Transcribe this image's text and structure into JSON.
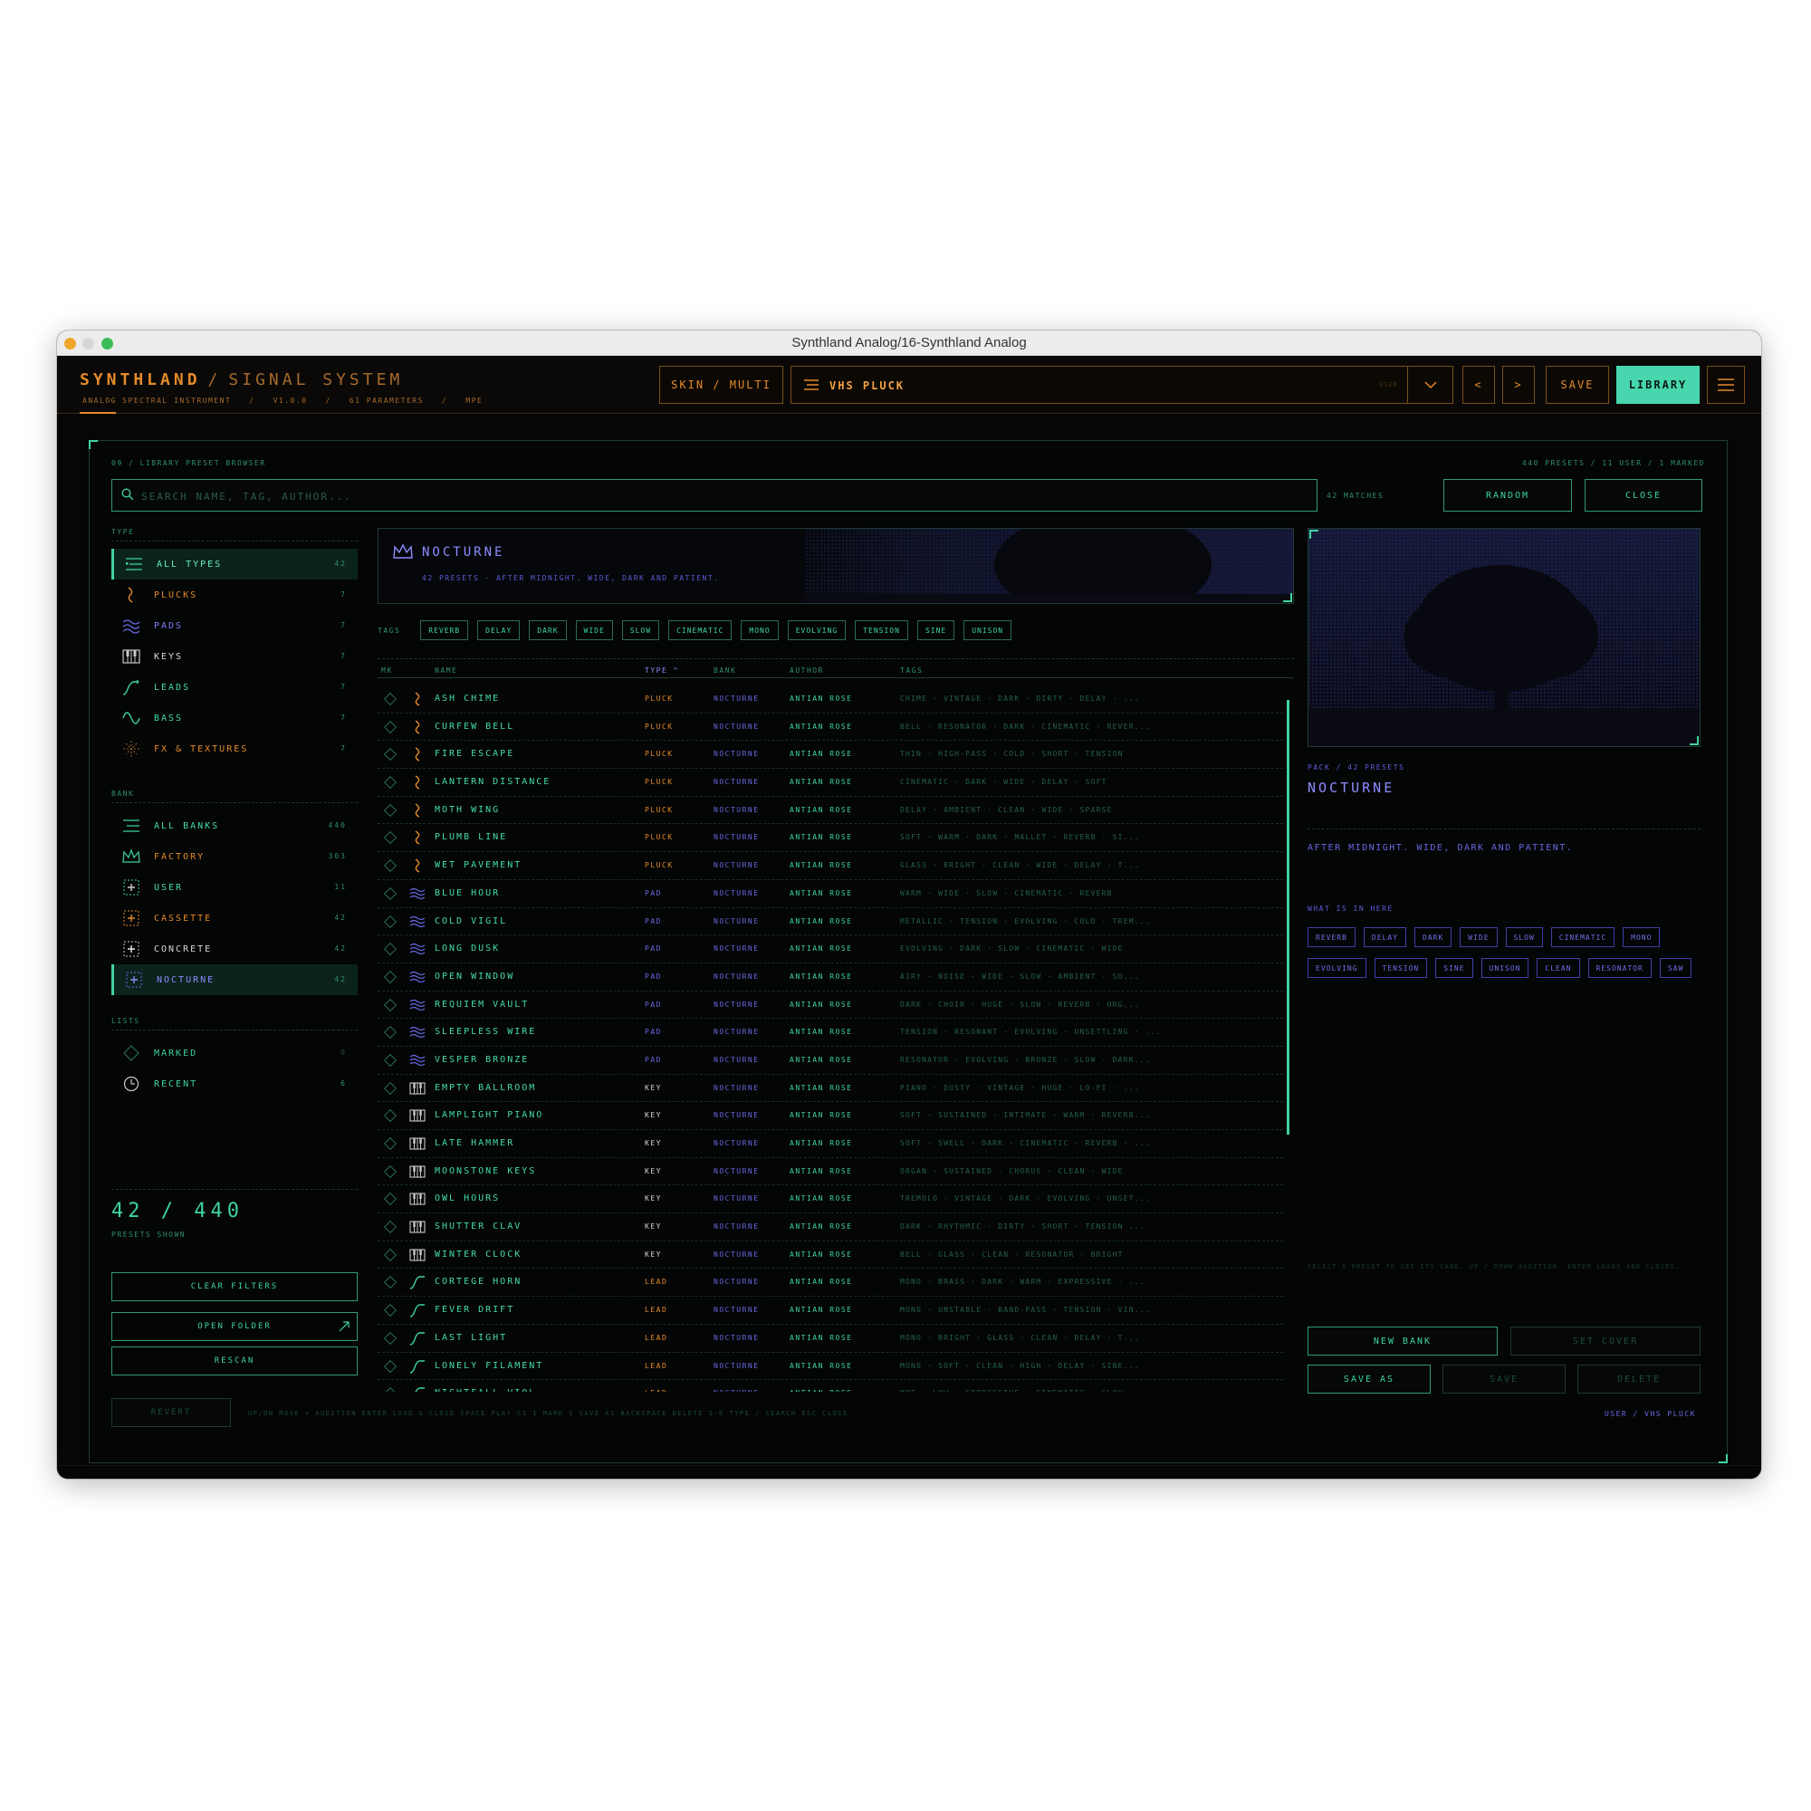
{
  "window": {
    "title": "Synthland Analog/16-Synthland Analog"
  },
  "header": {
    "brand": "SYNTHLAND",
    "brand_sep": "/",
    "brand_sub": "SIGNAL SYSTEM",
    "subline": [
      "ANALOG SPECTRAL INSTRUMENT",
      "/",
      "V1.0.0",
      "/",
      "61 PARAMETERS",
      "/",
      "MPE"
    ],
    "skin_label": "SKIN / MULTI",
    "preset_name": "VHS PLUCK",
    "preset_badge": "USER",
    "prev_label": "<",
    "next_label": ">",
    "save_label": "SAVE",
    "library_label": "LIBRARY"
  },
  "library": {
    "crumb": "09 / LIBRARY   PRESET BROWSER",
    "stats": "440 PRESETS  /  11 USER  /  1 MARKED",
    "search_placeholder": "SEARCH NAME, TAG, AUTHOR...",
    "matches": "42 MATCHES",
    "random_label": "RANDOM",
    "close_label": "CLOSE"
  },
  "sidebar": {
    "type_head": "TYPE",
    "types": [
      {
        "label": "ALL TYPES",
        "count": "42",
        "icon": "list-icon"
      },
      {
        "label": "PLUCKS",
        "count": "7",
        "icon": "pluck-icon"
      },
      {
        "label": "PADS",
        "count": "7",
        "icon": "wave-icon"
      },
      {
        "label": "KEYS",
        "count": "7",
        "icon": "keys-icon"
      },
      {
        "label": "LEADS",
        "count": "7",
        "icon": "lead-icon"
      },
      {
        "label": "BASS",
        "count": "7",
        "icon": "sine-icon"
      },
      {
        "label": "FX & TEXTURES",
        "count": "7",
        "icon": "sparkle-icon"
      }
    ],
    "bank_head": "BANK",
    "banks": [
      {
        "label": "ALL BANKS",
        "count": "440",
        "icon": "list-icon"
      },
      {
        "label": "FACTORY",
        "count": "303",
        "icon": "crown-icon"
      },
      {
        "label": "USER",
        "count": "11",
        "icon": "plus-box-icon"
      },
      {
        "label": "CASSETTE",
        "count": "42",
        "icon": "plus-box-icon"
      },
      {
        "label": "CONCRETE",
        "count": "42",
        "icon": "plus-box-icon"
      },
      {
        "label": "NOCTURNE",
        "count": "42",
        "icon": "plus-box-icon"
      }
    ],
    "lists_head": "LISTS",
    "lists": [
      {
        "label": "MARKED",
        "count": "0",
        "icon": "diamond-icon"
      },
      {
        "label": "RECENT",
        "count": "6",
        "icon": "clock-icon"
      }
    ],
    "count_text": "42 / 440",
    "count_sub": "PRESETS SHOWN",
    "clear_label": "CLEAR FILTERS",
    "open_label": "OPEN FOLDER",
    "rescan_label": "RESCAN"
  },
  "banner": {
    "title": "NOCTURNE",
    "sub": "42 PRESETS   ·   AFTER MIDNIGHT. WIDE, DARK AND PATIENT."
  },
  "tags": {
    "label": "TAGS",
    "items": [
      "REVERB",
      "DELAY",
      "DARK",
      "WIDE",
      "SLOW",
      "CINEMATIC",
      "MONO",
      "EVOLVING",
      "TENSION",
      "SINE",
      "UNISON"
    ]
  },
  "table": {
    "columns": {
      "mk": "MK",
      "name": "NAME",
      "type": "TYPE ^",
      "bank": "BANK",
      "author": "AUTHOR",
      "tags": "TAGS"
    },
    "rows": [
      {
        "name": "ASH CHIME",
        "type": "PLUCK",
        "bank": "NOCTURNE",
        "author": "ANTIAN ROSE",
        "tags": "CHIME · VINTAGE · DARK · DIRTY · DELAY · ..."
      },
      {
        "name": "CURFEW BELL",
        "type": "PLUCK",
        "bank": "NOCTURNE",
        "author": "ANTIAN ROSE",
        "tags": "BELL · RESONATOR · DARK · CINEMATIC · REVER..."
      },
      {
        "name": "FIRE ESCAPE",
        "type": "PLUCK",
        "bank": "NOCTURNE",
        "author": "ANTIAN ROSE",
        "tags": "THIN · HIGH-PASS · COLD · SHORT · TENSION"
      },
      {
        "name": "LANTERN DISTANCE",
        "type": "PLUCK",
        "bank": "NOCTURNE",
        "author": "ANTIAN ROSE",
        "tags": "CINEMATIC · DARK · WIDE · DELAY · SOFT"
      },
      {
        "name": "MOTH WING",
        "type": "PLUCK",
        "bank": "NOCTURNE",
        "author": "ANTIAN ROSE",
        "tags": "DELAY · AMBIENT · CLEAN · WIDE · SPARSE"
      },
      {
        "name": "PLUMB LINE",
        "type": "PLUCK",
        "bank": "NOCTURNE",
        "author": "ANTIAN ROSE",
        "tags": "SOFT · WARM · DARK · MALLET · REVERB · SI..."
      },
      {
        "name": "WET PAVEMENT",
        "type": "PLUCK",
        "bank": "NOCTURNE",
        "author": "ANTIAN ROSE",
        "tags": "GLASS · BRIGHT · CLEAN · WIDE · DELAY · T..."
      },
      {
        "name": "BLUE HOUR",
        "type": "PAD",
        "bank": "NOCTURNE",
        "author": "ANTIAN ROSE",
        "tags": "WARM · WIDE · SLOW · CINEMATIC · REVERB"
      },
      {
        "name": "COLD VIGIL",
        "type": "PAD",
        "bank": "NOCTURNE",
        "author": "ANTIAN ROSE",
        "tags": "METALLIC · TENSION · EVOLVING · COLD · TREM..."
      },
      {
        "name": "LONG DUSK",
        "type": "PAD",
        "bank": "NOCTURNE",
        "author": "ANTIAN ROSE",
        "tags": "EVOLVING · DARK · SLOW · CINEMATIC · WIDE"
      },
      {
        "name": "OPEN WINDOW",
        "type": "PAD",
        "bank": "NOCTURNE",
        "author": "ANTIAN ROSE",
        "tags": "AIRY · NOISE · WIDE · SLOW · AMBIENT · SO..."
      },
      {
        "name": "REQUIEM VAULT",
        "type": "PAD",
        "bank": "NOCTURNE",
        "author": "ANTIAN ROSE",
        "tags": "DARK · CHOIR · HUGE · SLOW · REVERB · ORG..."
      },
      {
        "name": "SLEEPLESS WIRE",
        "type": "PAD",
        "bank": "NOCTURNE",
        "author": "ANTIAN ROSE",
        "tags": "TENSION · RESONANT · EVOLVING · UNSETTLING · ..."
      },
      {
        "name": "VESPER BRONZE",
        "type": "PAD",
        "bank": "NOCTURNE",
        "author": "ANTIAN ROSE",
        "tags": "RESONATOR · EVOLVING · BRONZE · SLOW · DARK..."
      },
      {
        "name": "EMPTY BALLROOM",
        "type": "KEY",
        "bank": "NOCTURNE",
        "author": "ANTIAN ROSE",
        "tags": "PIANO · DUSTY · VINTAGE · HUGE · LO-FI · ..."
      },
      {
        "name": "LAMPLIGHT PIANO",
        "type": "KEY",
        "bank": "NOCTURNE",
        "author": "ANTIAN ROSE",
        "tags": "SOFT · SUSTAINED · INTIMATE · WARM · REVERB..."
      },
      {
        "name": "LATE HAMMER",
        "type": "KEY",
        "bank": "NOCTURNE",
        "author": "ANTIAN ROSE",
        "tags": "SOFT · SWELL · DARK · CINEMATIC · REVERB · ..."
      },
      {
        "name": "MOONSTONE KEYS",
        "type": "KEY",
        "bank": "NOCTURNE",
        "author": "ANTIAN ROSE",
        "tags": "ORGAN · SUSTAINED · CHORUS · CLEAN · WIDE"
      },
      {
        "name": "OWL HOURS",
        "type": "KEY",
        "bank": "NOCTURNE",
        "author": "ANTIAN ROSE",
        "tags": "TREMOLO · VINTAGE · DARK · EVOLVING · UNSET..."
      },
      {
        "name": "SHUTTER CLAV",
        "type": "KEY",
        "bank": "NOCTURNE",
        "author": "ANTIAN ROSE",
        "tags": "DARK · RHYTHMIC · DIRTY · SHORT · TENSION ..."
      },
      {
        "name": "WINTER CLOCK",
        "type": "KEY",
        "bank": "NOCTURNE",
        "author": "ANTIAN ROSE",
        "tags": "BELL · GLASS · CLEAN · RESONATOR · BRIGHT"
      },
      {
        "name": "CORTEGE HORN",
        "type": "LEAD",
        "bank": "NOCTURNE",
        "author": "ANTIAN ROSE",
        "tags": "MONO · BRASS · DARK · WARM · EXPRESSIVE · ..."
      },
      {
        "name": "FEVER DRIFT",
        "type": "LEAD",
        "bank": "NOCTURNE",
        "author": "ANTIAN ROSE",
        "tags": "MONO · UNSTABLE · BAND-PASS · TENSION · VIN..."
      },
      {
        "name": "LAST LIGHT",
        "type": "LEAD",
        "bank": "NOCTURNE",
        "author": "ANTIAN ROSE",
        "tags": "MONO · BRIGHT · GLASS · CLEAN · DELAY · T..."
      },
      {
        "name": "LONELY FILAMENT",
        "type": "LEAD",
        "bank": "NOCTURNE",
        "author": "ANTIAN ROSE",
        "tags": "MONO · SOFT · CLEAN · HIGH · DELAY · SINE..."
      },
      {
        "name": "NIGHTFALL VIOL",
        "type": "LEAD",
        "bank": "NOCTURNE",
        "author": "ANTIAN ROSE",
        "tags": "MPE · LOW · EXPRESSIVE · CINEMATIC · SLOW · ..."
      }
    ]
  },
  "detail": {
    "sub": "PACK  /  42 PRESETS",
    "title": "NOCTURNE",
    "desc": "AFTER MIDNIGHT. WIDE, DARK AND PATIENT.",
    "what_label": "WHAT IS IN HERE",
    "tags": [
      "REVERB",
      "DELAY",
      "DARK",
      "WIDE",
      "SLOW",
      "CINEMATIC",
      "MONO",
      "EVOLVING",
      "TENSION",
      "SINE",
      "UNISON",
      "CLEAN",
      "RESONATOR",
      "SAW"
    ],
    "hint": "SELECT A PRESET TO SEE ITS CARD.  UP / DOWN AUDITION.  ENTER LOADS AND CLOSES.",
    "new_bank": "NEW BANK",
    "set_cover": "SET COVER",
    "save_as": "SAVE AS",
    "save": "SAVE",
    "delete": "DELETE"
  },
  "footer": {
    "revert": "REVERT",
    "hint": "UP/DN MOVE + AUDITION   ENTER LOAD & CLOSE   SPACE PLAY C3   1 MARK   S SAVE AS   BACKSPACE DELETE   1-6 TYPE   / SEARCH   ESC CLOSE",
    "status": "USER  /  VHS PLUCK"
  },
  "colors": {
    "accent": "#3fd3a2",
    "orange": "#e58a2a",
    "violet": "#8b8cff"
  }
}
